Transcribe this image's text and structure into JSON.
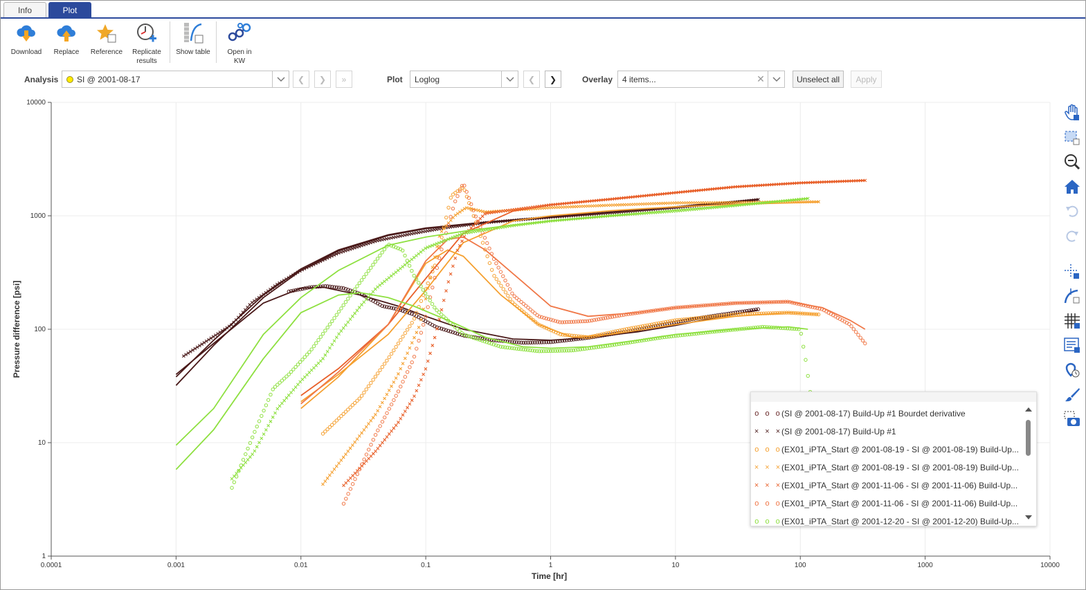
{
  "tabs": [
    {
      "label": "Info",
      "active": false
    },
    {
      "label": "Plot",
      "active": true
    }
  ],
  "toolbar": {
    "download": "Download",
    "replace": "Replace",
    "reference": "Reference",
    "replicate": "Replicate\nresults",
    "show_table": "Show table",
    "open_kw": "Open in\nKW"
  },
  "controls": {
    "analysis_label": "Analysis",
    "analysis_value": "SI @ 2001-08-17",
    "plot_label": "Plot",
    "plot_value": "Loglog",
    "overlay_label": "Overlay",
    "overlay_value": "4 items...",
    "unselect_all": "Unselect all",
    "apply": "Apply"
  },
  "icons": {
    "download": "cloud-download-icon",
    "replace": "cloud-upload-icon",
    "reference": "star-icon",
    "replicate": "clock-plus-icon",
    "show_table": "table-curve-icon",
    "open_kw": "molecule-icon"
  },
  "colors": {
    "accent": "#2c4a9c",
    "dark_brown": "#4a1a1a",
    "orange": "#f5a030",
    "red_orange": "#e8602a",
    "coral": "#f07848",
    "green": "#8ee040"
  },
  "chart_data": {
    "type": "scatter",
    "x_scale": "log",
    "y_scale": "log",
    "xlabel": "Time [hr]",
    "ylabel": "Pressure difference [psi]",
    "xlim": [
      0.0001,
      10000
    ],
    "ylim": [
      1,
      10000
    ],
    "x_ticks": [
      "0.0001",
      "0.001",
      "0.01",
      "0.1",
      "1",
      "10",
      "100",
      "1000",
      "10000"
    ],
    "y_ticks": [
      "1",
      "10",
      "100",
      "1000",
      "10000"
    ],
    "grid": true,
    "legend_position": "bottom-right",
    "legend": [
      {
        "label": "(SI @ 2001-08-17) Build-Up #1 Bourdet derivative",
        "symbol": "o o o",
        "color": "#4a1a1a"
      },
      {
        "label": "(SI @ 2001-08-17) Build-Up #1",
        "symbol": "× × ×",
        "color": "#4a1a1a"
      },
      {
        "label": "(EX01_iPTA_Start @ 2001-08-19 - SI @ 2001-08-19) Build-Up...",
        "symbol": "o o o",
        "color": "#f5a030"
      },
      {
        "label": "(EX01_iPTA_Start @ 2001-08-19 - SI @ 2001-08-19) Build-Up...",
        "symbol": "× × ×",
        "color": "#f5a030"
      },
      {
        "label": "(EX01_iPTA_Start @ 2001-11-06 - SI @ 2001-11-06) Build-Up...",
        "symbol": "× × ×",
        "color": "#e8602a"
      },
      {
        "label": "(EX01_iPTA_Start @ 2001-11-06 - SI @ 2001-11-06) Build-Up...",
        "symbol": "o o o",
        "color": "#f07848"
      },
      {
        "label": "(EX01_iPTA_Start @ 2001-12-20 - SI @ 2001-12-20) Build-Up...",
        "symbol": "o o o",
        "color": "#8ee040"
      }
    ],
    "series": [
      {
        "color": "#4a1a1a",
        "kind": "pressure_points",
        "x": [
          0.00115,
          0.0028,
          0.004,
          0.0065,
          0.01,
          0.02,
          0.04,
          0.08,
          0.15,
          0.3,
          1,
          3,
          10,
          30,
          46
        ],
        "y": [
          58,
          110,
          170,
          250,
          330,
          470,
          600,
          700,
          790,
          870,
          970,
          1060,
          1180,
          1320,
          1390
        ]
      },
      {
        "color": "#4a1a1a",
        "kind": "pressure_model",
        "x": [
          0.001,
          0.002,
          0.005,
          0.01,
          0.02,
          0.05,
          0.1,
          0.3,
          1,
          3,
          10,
          46
        ],
        "y": [
          38,
          80,
          200,
          340,
          500,
          680,
          780,
          880,
          980,
          1080,
          1200,
          1400
        ]
      },
      {
        "color": "#4a1a1a",
        "kind": "pressure_model",
        "x": [
          0.001,
          0.002,
          0.005,
          0.01,
          0.02,
          0.05,
          0.1,
          0.3,
          1,
          3,
          10,
          46
        ],
        "y": [
          32,
          72,
          190,
          330,
          490,
          670,
          770,
          870,
          970,
          1070,
          1190,
          1390
        ]
      },
      {
        "color": "#4a1a1a",
        "kind": "derivative_points",
        "x": [
          0.008,
          0.012,
          0.016,
          0.022,
          0.03,
          0.045,
          0.06,
          0.08,
          0.12,
          0.2,
          0.35,
          0.6,
          1,
          2,
          4,
          8,
          15,
          30,
          46
        ],
        "y": [
          215,
          235,
          240,
          230,
          205,
          160,
          150,
          135,
          105,
          88,
          80,
          76,
          77,
          84,
          95,
          110,
          125,
          140,
          150
        ]
      },
      {
        "color": "#4a1a1a",
        "kind": "derivative_model",
        "x": [
          0.001,
          0.002,
          0.005,
          0.01,
          0.015,
          0.03,
          0.06,
          0.1,
          0.2,
          0.5,
          1,
          2,
          5,
          10,
          20,
          46
        ],
        "y": [
          40,
          75,
          170,
          230,
          235,
          200,
          160,
          130,
          100,
          82,
          80,
          84,
          95,
          108,
          125,
          148
        ]
      },
      {
        "color": "#f5a030",
        "kind": "pressure_points",
        "x": [
          0.015,
          0.025,
          0.04,
          0.06,
          0.09,
          0.13,
          0.17,
          0.21,
          0.3,
          1,
          3,
          10,
          30,
          60,
          140
        ],
        "y": [
          4.3,
          9,
          18,
          40,
          110,
          700,
          1000,
          1180,
          1080,
          1180,
          1240,
          1300,
          1310,
          1320,
          1330
        ]
      },
      {
        "color": "#f5a030",
        "kind": "pressure_model",
        "x": [
          0.01,
          0.02,
          0.05,
          0.1,
          0.2,
          0.5,
          1,
          3,
          10,
          30,
          140
        ],
        "y": [
          23,
          40,
          90,
          220,
          580,
          900,
          1000,
          1110,
          1200,
          1260,
          1320
        ]
      },
      {
        "color": "#f5a030",
        "kind": "derivative_points",
        "x": [
          0.015,
          0.03,
          0.05,
          0.08,
          0.12,
          0.16,
          0.2,
          0.25,
          0.35,
          0.5,
          0.8,
          1.2,
          2,
          4,
          10,
          30,
          80,
          140
        ],
        "y": [
          12,
          25,
          55,
          120,
          380,
          1500,
          1800,
          900,
          300,
          170,
          110,
          90,
          85,
          100,
          120,
          135,
          140,
          135
        ]
      },
      {
        "color": "#f5a030",
        "kind": "derivative_model",
        "x": [
          0.01,
          0.02,
          0.05,
          0.1,
          0.15,
          0.2,
          0.4,
          0.8,
          1.5,
          3,
          10,
          30,
          80,
          140
        ],
        "y": [
          20,
          38,
          110,
          380,
          500,
          440,
          200,
          110,
          85,
          90,
          110,
          130,
          140,
          135
        ]
      },
      {
        "color": "#e8602a",
        "kind": "pressure_points",
        "x": [
          0.022,
          0.04,
          0.06,
          0.08,
          0.1,
          0.12,
          0.15,
          0.18,
          0.21,
          0.3,
          1,
          3,
          10,
          30,
          100,
          330
        ],
        "y": [
          4.2,
          8.5,
          15,
          25,
          45,
          90,
          250,
          500,
          700,
          1050,
          1250,
          1400,
          1600,
          1800,
          1950,
          2050
        ]
      },
      {
        "color": "#e8602a",
        "kind": "pressure_model",
        "x": [
          0.01,
          0.02,
          0.05,
          0.1,
          0.2,
          0.5,
          1,
          3,
          10,
          30,
          100,
          330
        ],
        "y": [
          26,
          45,
          110,
          280,
          700,
          1100,
          1250,
          1400,
          1600,
          1800,
          1950,
          2050
        ]
      },
      {
        "color": "#f07848",
        "kind": "derivative_points",
        "x": [
          0.022,
          0.04,
          0.06,
          0.08,
          0.1,
          0.13,
          0.17,
          0.2,
          0.25,
          0.35,
          0.5,
          0.8,
          1.2,
          2,
          4,
          10,
          30,
          80,
          150,
          250,
          330
        ],
        "y": [
          2.9,
          12,
          28,
          55,
          130,
          450,
          1300,
          1950,
          1000,
          420,
          200,
          130,
          115,
          118,
          135,
          155,
          170,
          175,
          150,
          110,
          75
        ]
      },
      {
        "color": "#f07848",
        "kind": "derivative_model",
        "x": [
          0.01,
          0.02,
          0.05,
          0.1,
          0.15,
          0.2,
          0.3,
          0.6,
          1,
          2,
          5,
          10,
          30,
          80,
          150,
          250,
          330
        ],
        "y": [
          22,
          42,
          110,
          400,
          620,
          650,
          500,
          260,
          160,
          130,
          140,
          155,
          170,
          175,
          155,
          120,
          100
        ]
      },
      {
        "color": "#8ee040",
        "kind": "pressure_points",
        "x": [
          0.0028,
          0.0042,
          0.0065,
          0.01,
          0.015,
          0.02,
          0.03,
          0.04,
          0.06,
          0.1,
          0.2,
          0.5,
          1,
          3,
          10,
          30,
          115
        ],
        "y": [
          4.8,
          8.2,
          20,
          35,
          55,
          90,
          160,
          230,
          330,
          520,
          700,
          820,
          900,
          1000,
          1100,
          1230,
          1420
        ]
      },
      {
        "color": "#8ee040",
        "kind": "pressure_model",
        "x": [
          0.001,
          0.002,
          0.005,
          0.01,
          0.02,
          0.05,
          0.1,
          0.2,
          0.5,
          1,
          3,
          10,
          30,
          115
        ],
        "y": [
          9.5,
          20,
          90,
          190,
          330,
          550,
          650,
          730,
          830,
          900,
          1000,
          1120,
          1240,
          1420
        ]
      },
      {
        "color": "#8ee040",
        "kind": "derivative_points",
        "x": [
          0.0028,
          0.0042,
          0.006,
          0.008,
          0.012,
          0.018,
          0.025,
          0.035,
          0.05,
          0.065,
          0.08,
          0.12,
          0.2,
          0.4,
          0.8,
          1.5,
          3,
          8,
          20,
          50,
          100,
          110,
          120
        ],
        "y": [
          4,
          12,
          30,
          40,
          65,
          120,
          200,
          330,
          560,
          500,
          300,
          150,
          90,
          70,
          64,
          65,
          72,
          85,
          95,
          105,
          100,
          55,
          28
        ]
      },
      {
        "color": "#8ee040",
        "kind": "derivative_model",
        "x": [
          0.001,
          0.002,
          0.005,
          0.01,
          0.02,
          0.03,
          0.05,
          0.08,
          0.15,
          0.3,
          0.6,
          1,
          2,
          5,
          10,
          30,
          80,
          115
        ],
        "y": [
          5.8,
          13,
          55,
          140,
          200,
          210,
          190,
          160,
          120,
          85,
          70,
          68,
          70,
          80,
          90,
          100,
          105,
          100
        ]
      }
    ]
  }
}
